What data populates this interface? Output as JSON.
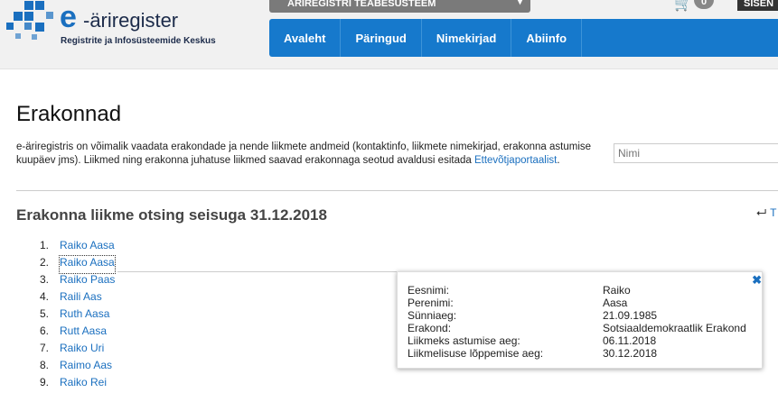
{
  "header": {
    "logo_e": "e",
    "logo_name": "-äriregister",
    "logo_sub": "Registrite ja Infosüsteemide Keskus",
    "system_select": "ÄRIREGISTRI TEABESÜSTEEM",
    "cart_count": "0",
    "login_label": "SISEN"
  },
  "nav": {
    "items": [
      "Avaleht",
      "Päringud",
      "Nimekirjad",
      "Abiinfo"
    ]
  },
  "page": {
    "title": "Erakonnad",
    "intro_text": "e-äriregistris on võimalik vaadata erakondade ja nende liikmete andmeid (kontaktinfo, liikmete nimekirjad, erakonna astumise kuupäev jms). Liikmed ning erakonna juhatuse liikmed saavad erakonnaga seotud avaldusi esitada ",
    "intro_link": "Ettevõtjaportaalist",
    "intro_end": ".",
    "search_placeholder": "Nimi",
    "section_title": "Erakonna liikme otsing seisuga 31.12.2018",
    "back_label": "T"
  },
  "members": [
    {
      "num": "1.",
      "name": "Raiko Aasa"
    },
    {
      "num": "2.",
      "name": "Raiko Aasa"
    },
    {
      "num": "3.",
      "name": "Raiko Paas"
    },
    {
      "num": "4.",
      "name": "Raili Aas"
    },
    {
      "num": "5.",
      "name": "Ruth Aasa"
    },
    {
      "num": "6.",
      "name": "Rutt Aasa"
    },
    {
      "num": "7.",
      "name": "Raiko Uri"
    },
    {
      "num": "8.",
      "name": "Raimo Aas"
    },
    {
      "num": "9.",
      "name": "Raiko Rei"
    }
  ],
  "popup": {
    "rows": [
      {
        "label": "Eesnimi:",
        "value": "Raiko"
      },
      {
        "label": "Perenimi:",
        "value": "Aasa"
      },
      {
        "label": "Sünniaeg:",
        "value": "21.09.1985"
      },
      {
        "label": "Erakond:",
        "value": "Sotsiaaldemokraatlik Erakond"
      },
      {
        "label": "Liikmeks astumise aeg:",
        "value": "06.11.2018"
      },
      {
        "label": "Liikmelisuse lõppemise aeg:",
        "value": "30.12.2018"
      }
    ]
  },
  "colors": {
    "nav": "#1679cc",
    "link": "#1a6fbf"
  }
}
